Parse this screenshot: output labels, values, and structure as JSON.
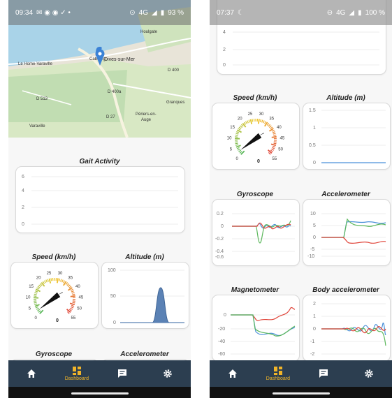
{
  "left_phone": {
    "status": {
      "time": "09:34",
      "network": "4G",
      "battery": "93 %"
    },
    "map": {
      "place_labels": [
        "Houlgate",
        "Cabourg",
        "Le Home-Varaville",
        "Dives-sur-Mer",
        "D 400a",
        "D 513",
        "D 27",
        "Périers-en-",
        "Auge",
        "Varaville",
        "Granques",
        "D 400"
      ]
    },
    "gait": {
      "title": "Gait Activity",
      "y_ticks": [
        "6",
        "4",
        "2",
        "0"
      ]
    },
    "speed": {
      "title": "Speed (km/h)",
      "ticks": [
        "0",
        "5",
        "10",
        "15",
        "20",
        "25",
        "30",
        "35",
        "40",
        "45",
        "50",
        "55"
      ],
      "value": "0"
    },
    "altitude": {
      "title": "Altitude (m)",
      "y_ticks": [
        "100",
        "50",
        "0"
      ],
      "peak_value": 65
    },
    "gyroscope": {
      "title": "Gyroscope"
    },
    "accelerometer": {
      "title": "Accelerometer"
    }
  },
  "right_phone": {
    "status": {
      "time": "07:37",
      "network": "4G",
      "battery": "100 %"
    },
    "top_chart": {
      "y_ticks": [
        "4",
        "2",
        "0"
      ]
    },
    "speed": {
      "title": "Speed (km/h)",
      "ticks": [
        "0",
        "5",
        "10",
        "15",
        "20",
        "25",
        "30",
        "35",
        "40",
        "45",
        "50",
        "55"
      ],
      "value": "0"
    },
    "altitude": {
      "title": "Altitude (m)",
      "y_ticks": [
        "1.5",
        "1",
        "0.5",
        "0"
      ]
    },
    "gyroscope": {
      "title": "Gyroscope",
      "y_ticks": [
        "0.2",
        "0",
        "-0.2",
        "-0.4",
        "-0.6"
      ]
    },
    "accelerometer": {
      "title": "Accelerometer",
      "y_ticks": [
        "10",
        "5",
        "0",
        "-5",
        "-10"
      ]
    },
    "magnetometer": {
      "title": "Magnetometer",
      "y_ticks": [
        "0",
        "-20",
        "-40",
        "-60"
      ]
    },
    "body_accelerometer": {
      "title": "Body accelerometer",
      "y_ticks": [
        "2",
        "1",
        "0",
        "-1",
        "-2"
      ]
    }
  },
  "nav": {
    "items": [
      {
        "icon": "home-icon",
        "label": ""
      },
      {
        "icon": "dashboard-icon",
        "label": "Dashboard"
      },
      {
        "icon": "chat-icon",
        "label": ""
      },
      {
        "icon": "gear-icon",
        "label": ""
      }
    ]
  },
  "colors": {
    "navbar": "#2c3e50",
    "active": "#f0b429",
    "series_blue": "#4a90d9",
    "series_green": "#5cb85c",
    "series_red": "#e0453a",
    "altitude_fill": "#5b82b5",
    "map_water": "#a9d3e8",
    "map_land": "#e8e4d8",
    "map_green": "#bfdcb0",
    "pin": "#3b82d6"
  }
}
